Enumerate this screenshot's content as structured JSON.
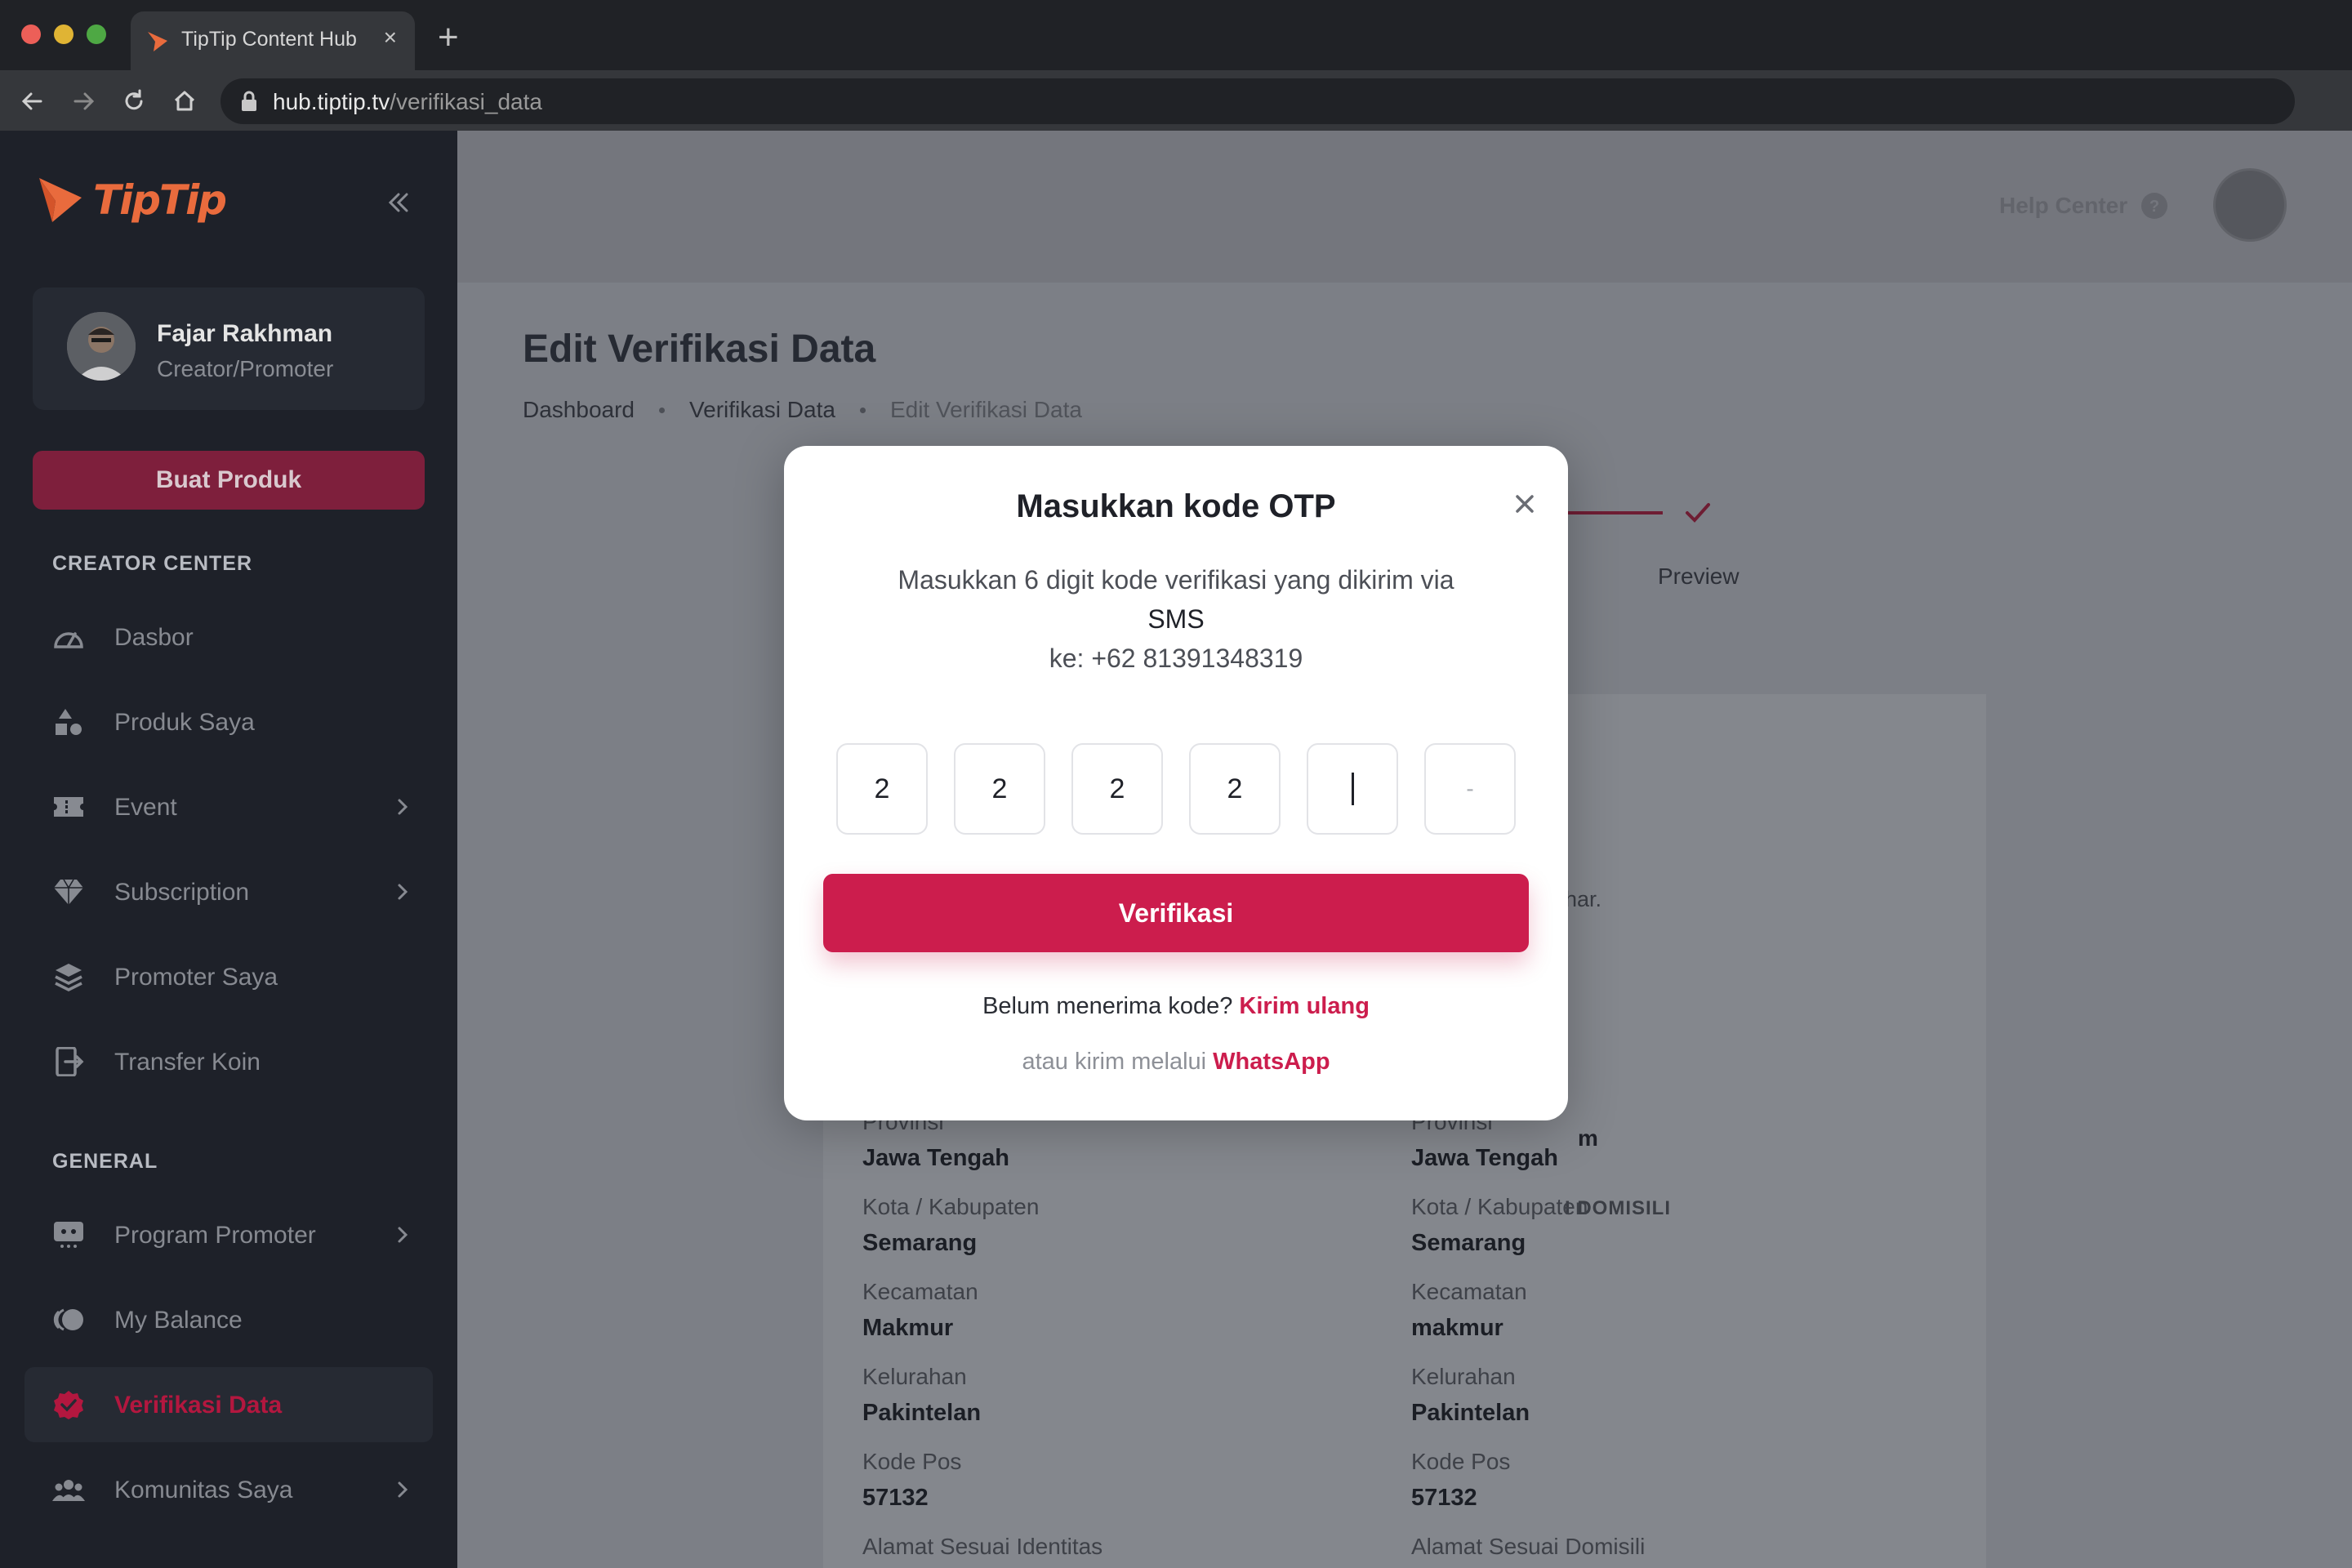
{
  "browser": {
    "tab_title": "TipTip Content Hub",
    "url_host": "hub.tiptip.tv",
    "url_path": "/verifikasi_data"
  },
  "sidebar": {
    "brand": "TipTip",
    "user": {
      "name": "Fajar Rakhman",
      "role": "Creator/Promoter"
    },
    "cta_label": "Buat Produk",
    "section_creator": "CREATOR CENTER",
    "creator_items": [
      {
        "label": "Dasbor",
        "icon": "gauge-icon",
        "chevron": false
      },
      {
        "label": "Produk Saya",
        "icon": "shapes-icon",
        "chevron": false
      },
      {
        "label": "Event",
        "icon": "ticket-icon",
        "chevron": true
      },
      {
        "label": "Subscription",
        "icon": "diamond-icon",
        "chevron": true
      },
      {
        "label": "Promoter Saya",
        "icon": "layers-icon",
        "chevron": false
      },
      {
        "label": "Transfer Koin",
        "icon": "transfer-icon",
        "chevron": false
      }
    ],
    "section_general": "GENERAL",
    "general_items": [
      {
        "label": "Program Promoter",
        "icon": "promoter-program-icon",
        "chevron": true
      },
      {
        "label": "My Balance",
        "icon": "coins-icon",
        "chevron": false
      },
      {
        "label": "Verifikasi Data",
        "icon": "verified-badge-icon",
        "chevron": false,
        "active": true
      },
      {
        "label": "Komunitas Saya",
        "icon": "community-icon",
        "chevron": true
      }
    ],
    "accent_color": "#cc1d4d"
  },
  "header": {
    "help_label": "Help Center"
  },
  "page": {
    "title": "Edit Verifikasi Data",
    "breadcrumb": [
      "Dashboard",
      "Verifikasi Data",
      "Edit Verifikasi Data"
    ],
    "step_label": "Preview",
    "fragments": {
      "helper_tail": "har.",
      "email_tail": "m",
      "domicile_heading_tail": "I DOMISILI"
    },
    "identity_address": [
      {
        "label": "Provinsi",
        "value": "Jawa Tengah"
      },
      {
        "label": "Kota / Kabupaten",
        "value": "Semarang"
      },
      {
        "label": "Kecamatan",
        "value": "Makmur"
      },
      {
        "label": "Kelurahan",
        "value": "Pakintelan"
      },
      {
        "label": "Kode Pos",
        "value": "57132"
      }
    ],
    "identity_address_footer": "Alamat Sesuai Identitas",
    "domicile_address": [
      {
        "label": "Provinsi",
        "value": "Jawa Tengah"
      },
      {
        "label": "Kota / Kabupaten",
        "value": "Semarang"
      },
      {
        "label": "Kecamatan",
        "value": "makmur"
      },
      {
        "label": "Kelurahan",
        "value": "Pakintelan"
      },
      {
        "label": "Kode Pos",
        "value": "57132"
      }
    ],
    "domicile_address_footer": "Alamat Sesuai Domisili"
  },
  "modal": {
    "title": "Masukkan kode OTP",
    "desc_line1": "Masukkan 6 digit kode verifikasi yang dikirim via",
    "desc_channel": "SMS",
    "desc_line3": "ke: +62 81391348319",
    "otp_digits": [
      "2",
      "2",
      "2",
      "2",
      "",
      "-"
    ],
    "verify_label": "Verifikasi",
    "resend_prompt": "Belum menerima kode?",
    "resend_link": "Kirim ulang",
    "alt_prompt": "atau kirim melalui",
    "alt_link": "WhatsApp"
  }
}
